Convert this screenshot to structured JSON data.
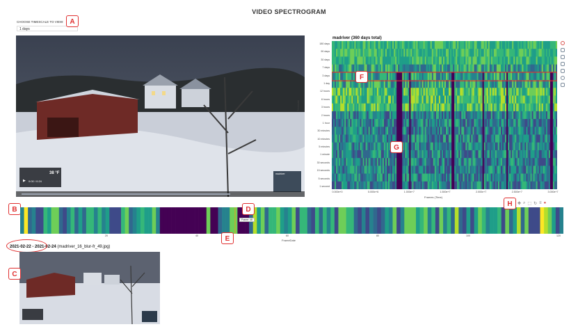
{
  "page": {
    "title": "VIDEO SPECTROGRAM"
  },
  "timescale": {
    "label": "CHOOSE TIMESCALE TO VIEW:",
    "selected": "1 days"
  },
  "callouts": {
    "A": "A",
    "B": "B",
    "C": "C",
    "D": "D",
    "E": "E",
    "F": "F",
    "G": "G",
    "H": "H"
  },
  "video": {
    "weather_temp": "38 °F",
    "time_display": "0:00 / 0:24",
    "watermark": "madriver"
  },
  "spectrogram": {
    "title": "madriver (360 days total)",
    "ylabel": "Timescale",
    "xlabel": "Frames (Time)",
    "y_ticks": [
      "180 days",
      "90 days",
      "30 days",
      "7 days",
      "3 days",
      "1 day",
      "12 hours",
      "6 hours",
      "3 hours",
      "2 hours",
      "1 hour",
      "30 minutes",
      "10 minutes",
      "5 minutes",
      "1 minute",
      "30 seconds",
      "15 seconds",
      "5 seconds",
      "1 second"
    ],
    "x_ticks": [
      "0.000e+0",
      "5.000e+6",
      "1.000e+7",
      "1.500e+7",
      "2.000e+7",
      "2.500e+7",
      "3.000e+7"
    ],
    "highlight_color": "#e03030"
  },
  "strip": {
    "xlabel": "FrameDate",
    "x_ticks": [
      "20",
      "40",
      "60",
      "80",
      "100",
      "120"
    ],
    "tooltip": "Frame: 48"
  },
  "selection": {
    "date_range": "2021-02-22 - 2021-02-24",
    "filename": "(madriver_16_blur-fr_49.jpg)"
  },
  "palette": {
    "viridis": [
      "#440154",
      "#482878",
      "#3e4a89",
      "#31688e",
      "#26828e",
      "#1f9e89",
      "#35b779",
      "#6ece58",
      "#b5de2b",
      "#fde725"
    ]
  }
}
